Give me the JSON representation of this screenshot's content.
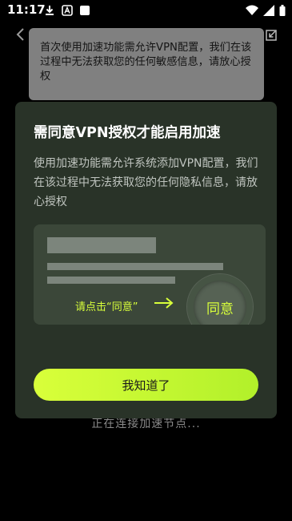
{
  "status_bar": {
    "time": "11:17",
    "left_icons": [
      "download-icon",
      "a-badge-icon",
      "white-square-icon"
    ],
    "right_icons": [
      "wifi-icon",
      "signal-icon",
      "battery-icon"
    ]
  },
  "background": {
    "status_text": "正在连接加速节点..."
  },
  "toast": {
    "text": "首次使用加速功能需允许VPN配置，我们在该过程中无法获取您的任何敏感信息，请放心授权"
  },
  "dialog": {
    "title": "需同意VPN授权才能启用加速",
    "description": "使用加速功能需允许系统添加VPN配置，我们在该过程中无法获取您的任何隐私信息，请放心授权",
    "illustration": {
      "hint": "请点击“同意”",
      "agree_label": "同意"
    },
    "confirm_label": "我知道了"
  },
  "colors": {
    "accent": "#d8ff3a",
    "dialog_bg": "#293328",
    "toast_bg": "#808080"
  }
}
